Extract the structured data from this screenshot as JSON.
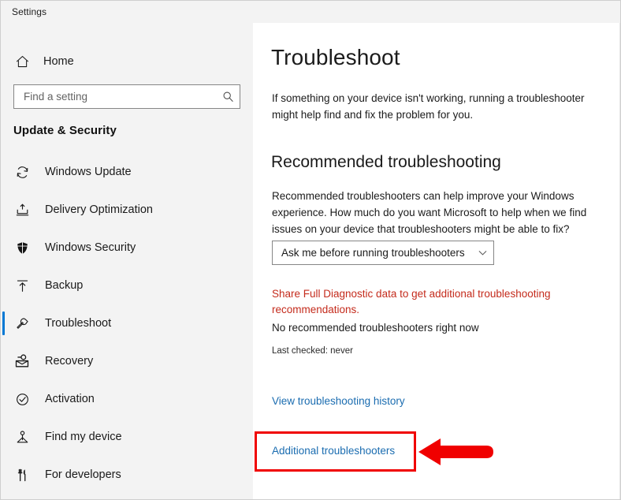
{
  "window": {
    "title": "Settings"
  },
  "sidebar": {
    "home": {
      "label": "Home",
      "icon": "home-icon"
    },
    "search": {
      "placeholder": "Find a setting",
      "value": "",
      "icon": "search-icon"
    },
    "group_title": "Update & Security",
    "items": [
      {
        "label": "Windows Update",
        "icon": "refresh-icon",
        "selected": false
      },
      {
        "label": "Delivery Optimization",
        "icon": "upload-tray-icon",
        "selected": false
      },
      {
        "label": "Windows Security",
        "icon": "shield-icon",
        "selected": false
      },
      {
        "label": "Backup",
        "icon": "upload-arrow-icon",
        "selected": false
      },
      {
        "label": "Troubleshoot",
        "icon": "wrench-icon",
        "selected": true
      },
      {
        "label": "Recovery",
        "icon": "recovery-icon",
        "selected": false
      },
      {
        "label": "Activation",
        "icon": "check-circle-icon",
        "selected": false
      },
      {
        "label": "Find my device",
        "icon": "locate-device-icon",
        "selected": false
      },
      {
        "label": "For developers",
        "icon": "developer-tools-icon",
        "selected": false
      }
    ]
  },
  "main": {
    "page_title": "Troubleshoot",
    "page_description": "If something on your device isn't working, running a troubleshooter might help find and fix the problem for you.",
    "section": {
      "title": "Recommended troubleshooting",
      "description": "Recommended troubleshooters can help improve your Windows experience. How much do you want Microsoft to help when we find issues on your device that troubleshooters might be able to fix?",
      "dropdown": {
        "value": "Ask me before running troubleshooters",
        "chevron_icon": "chevron-down-icon"
      },
      "warning": "Share Full Diagnostic data to get additional troubleshooting recommendations.",
      "status": "No recommended troubleshooters right now",
      "last_checked": "Last checked: never"
    },
    "links": {
      "history": "View troubleshooting history",
      "additional": "Additional troubleshooters"
    }
  },
  "annotation": {
    "highlight_color": "#f00000",
    "arrow_icon": "left-arrow-annotation"
  },
  "colors": {
    "accent": "#0078d4",
    "link": "#1a6cb0",
    "warning": "#c42b1c",
    "sidebar_bg": "#f3f3f3",
    "main_bg": "#ffffff"
  }
}
